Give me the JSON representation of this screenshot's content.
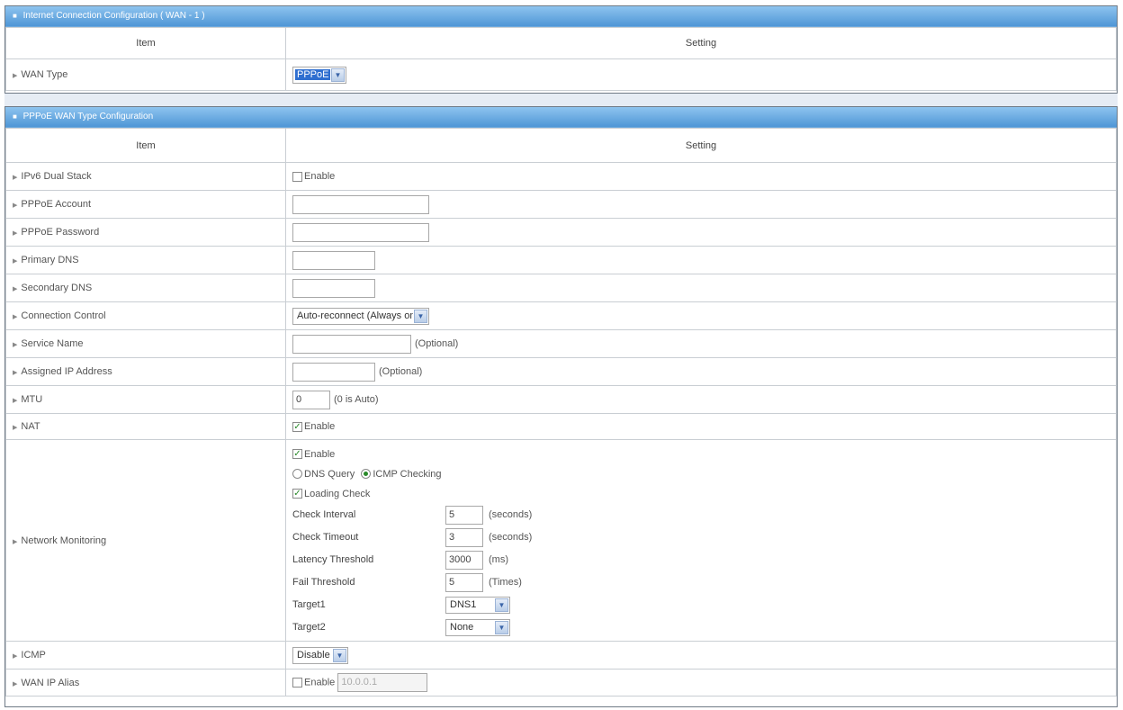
{
  "wan": {
    "title": "Internet Connection Configuration ( WAN - 1 )",
    "col_item": "Item",
    "col_setting": "Setting",
    "wan_type_label": "WAN Type",
    "wan_type_value": "PPPoE"
  },
  "pppoe": {
    "title": "PPPoE WAN Type Configuration",
    "col_item": "Item",
    "col_setting": "Setting",
    "ipv6_label": "IPv6 Dual Stack",
    "enable_text": "Enable",
    "account_label": "PPPoE Account",
    "password_label": "PPPoE Password",
    "primary_dns_label": "Primary DNS",
    "secondary_dns_label": "Secondary DNS",
    "conn_control_label": "Connection Control",
    "conn_control_value": "Auto-reconnect (Always on)",
    "service_name_label": "Service Name",
    "optional_text": "(Optional)",
    "assigned_ip_label": "Assigned IP Address",
    "mtu_label": "MTU",
    "mtu_value": "0",
    "mtu_hint": "(0 is Auto)",
    "nat_label": "NAT",
    "nm_label": "Network Monitoring",
    "nm_dns_query": "DNS Query",
    "nm_icmp_checking": "ICMP Checking",
    "nm_loading_check": "Loading Check",
    "check_interval_label": "Check Interval",
    "check_interval_value": "5",
    "seconds": "(seconds)",
    "check_timeout_label": "Check Timeout",
    "check_timeout_value": "3",
    "latency_label": "Latency Threshold",
    "latency_value": "3000",
    "ms": "(ms)",
    "fail_label": "Fail Threshold",
    "fail_value": "5",
    "times": "(Times)",
    "target1_label": "Target1",
    "target1_value": "DNS1",
    "target2_label": "Target2",
    "target2_value": "None",
    "icmp_label": "ICMP",
    "icmp_value": "Disable",
    "alias_label": "WAN IP Alias",
    "alias_placeholder": "10.0.0.1"
  },
  "colors": {
    "header_top": "#8ec4ef",
    "header_bottom": "#4f96d6",
    "check": "#2a8a2a"
  },
  "icons": {
    "dropdown": "chevron-down-icon",
    "row": "triangle-right-icon"
  }
}
